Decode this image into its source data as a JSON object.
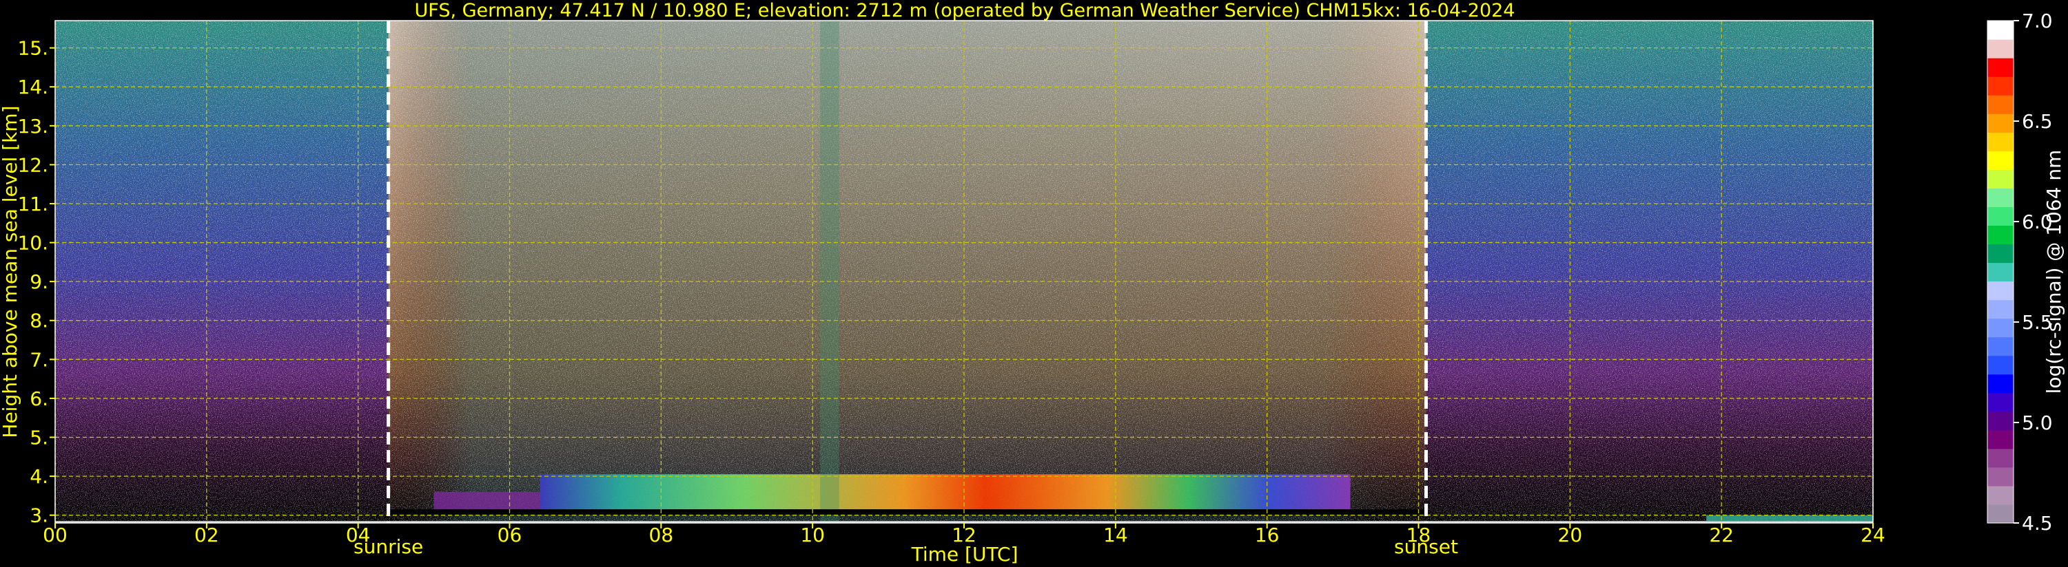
{
  "chart_data": {
    "type": "heatmap",
    "title": "UFS, Germany; 47.417 N / 10.980 E; elevation: 2712 m  (operated by German Weather Service)    CHM15kx: 16-04-2024",
    "xlabel": "Time [UTC]",
    "ylabel": "Height above mean sea level [km]",
    "colorbar_label": "log(rc-signal) @ 1064 nm",
    "xlim": [
      0,
      24
    ],
    "ylim": [
      2.8,
      15.7
    ],
    "clim": [
      4.5,
      7.0
    ],
    "x_ticks": [
      "00",
      "02",
      "04",
      "06",
      "08",
      "10",
      "12",
      "14",
      "16",
      "18",
      "20",
      "22",
      "24"
    ],
    "y_ticks": [
      "3.",
      "4.",
      "5.",
      "6.",
      "7.",
      "8.",
      "9.",
      "10.",
      "11.",
      "12.",
      "13.",
      "14.",
      "15."
    ],
    "colorbar_ticks": [
      "4.5",
      "5.0",
      "5.5",
      "6.0",
      "6.5",
      "7.0"
    ],
    "grid": true,
    "annotations": [
      {
        "label": "sunrise",
        "time": 4.4
      },
      {
        "label": "sunset",
        "time": 18.1
      }
    ],
    "colors": {
      "axis_text": "#ffff00",
      "grid": "#c8c800",
      "event_line": "#ffffff",
      "background": "#000000"
    },
    "colorbar_colors": [
      "#9e8ea8",
      "#b494b4",
      "#a060a0",
      "#903c90",
      "#780078",
      "#5c0090",
      "#3c00c8",
      "#0000ff",
      "#2850ff",
      "#5078ff",
      "#7896ff",
      "#9aaeff",
      "#bcc8ff",
      "#3cc8b4",
      "#00a064",
      "#00c83c",
      "#3ce678",
      "#78f09a",
      "#c8ff3c",
      "#ffff00",
      "#ffd200",
      "#ffa000",
      "#ff6e00",
      "#ff3200",
      "#ff0000",
      "#f0c8c8",
      "#ffffff"
    ]
  }
}
